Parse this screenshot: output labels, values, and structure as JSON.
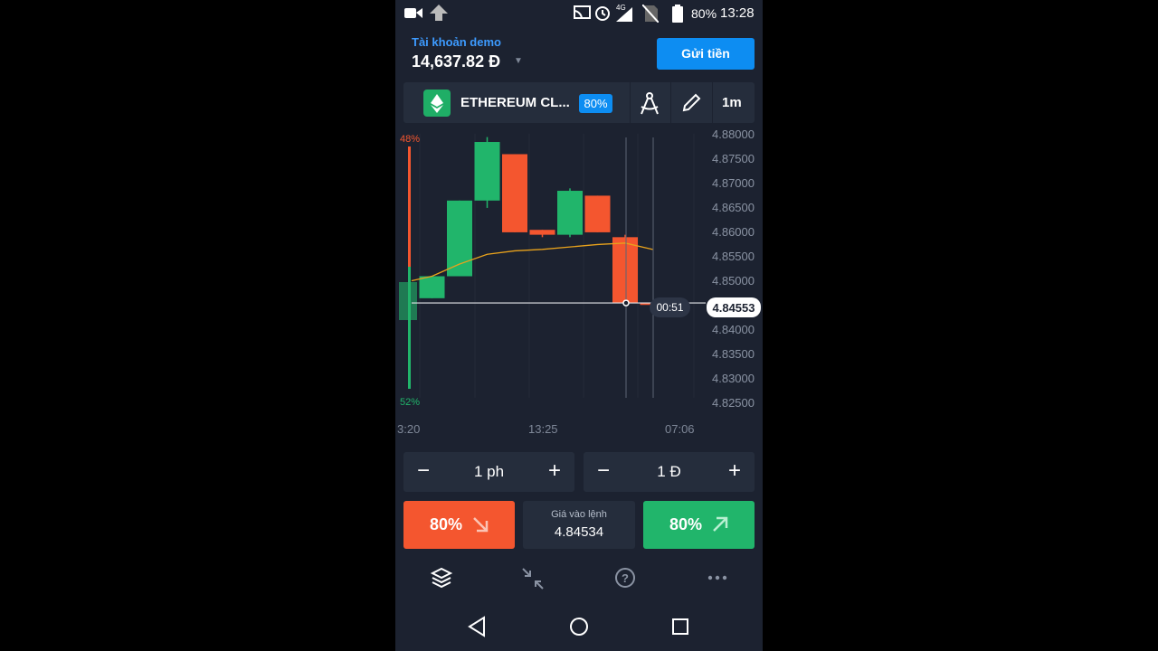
{
  "status_bar": {
    "battery": "80%",
    "time": "13:28",
    "network": "4G"
  },
  "account": {
    "label": "Tài khoản demo",
    "balance": "14,637.82 Đ",
    "deposit_button": "Gửi tiền"
  },
  "asset": {
    "name": "ETHEREUM CL...",
    "payout": "80%",
    "timeframe": "1m",
    "icon": "ethereum-icon"
  },
  "chart_data": {
    "type": "candlestick",
    "sentiment": {
      "top": "48%",
      "bottom": "52%"
    },
    "y_ticks": [
      "4.88000",
      "4.87500",
      "4.87000",
      "4.86500",
      "4.86000",
      "4.85500",
      "4.85000",
      "4.84000",
      "4.83500",
      "4.83000",
      "4.82500"
    ],
    "ylim": [
      4.82425,
      4.88165
    ],
    "x_ticks": [
      "3:20",
      "13:25",
      "07:06"
    ],
    "current_price": "4.84553",
    "countdown": "00:51",
    "candles": [
      {
        "open": 4.8465,
        "close": 4.851,
        "high": 4.851,
        "low": 4.8465
      },
      {
        "open": 4.851,
        "close": 4.8665,
        "high": 4.8665,
        "low": 4.851
      },
      {
        "open": 4.8665,
        "close": 4.8785,
        "high": 4.8795,
        "low": 4.865
      },
      {
        "open": 4.876,
        "close": 4.86,
        "high": 4.876,
        "low": 4.86
      },
      {
        "open": 4.8605,
        "close": 4.8595,
        "high": 4.8605,
        "low": 4.859
      },
      {
        "open": 4.8595,
        "close": 4.8685,
        "high": 4.869,
        "low": 4.859
      },
      {
        "open": 4.8675,
        "close": 4.86,
        "high": 4.8675,
        "low": 4.86
      },
      {
        "open": 4.859,
        "close": 4.8455,
        "high": 4.8595,
        "low": 4.8455
      },
      {
        "open": 4.8455,
        "close": 4.8452,
        "high": 4.8457,
        "low": 4.8452
      }
    ],
    "moving_average": [
      4.851,
      4.8535,
      4.8555,
      4.8562,
      4.8565,
      4.857,
      4.8575,
      4.8578,
      4.8565
    ]
  },
  "controls": {
    "duration": {
      "minus": "−",
      "value": "1 ph",
      "plus": "+"
    },
    "amount": {
      "minus": "−",
      "value": "1 Đ",
      "plus": "+"
    }
  },
  "trade": {
    "sell_pct": "80%",
    "buy_pct": "80%",
    "entry_label": "Giá vào lệnh",
    "entry_price": "4.84534"
  },
  "colors": {
    "up": "#21b56b",
    "down": "#f4562f",
    "accent": "#0d8df2",
    "ma": "#e8a21c"
  }
}
